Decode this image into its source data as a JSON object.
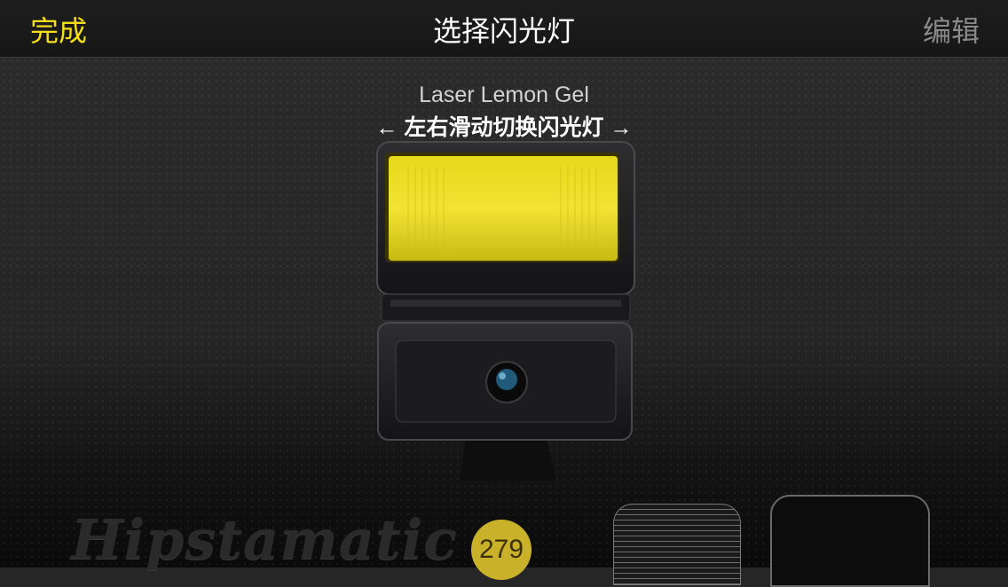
{
  "navbar": {
    "done_label": "完成",
    "title": "选择闪光灯",
    "edit_label": "编辑"
  },
  "flash": {
    "name": "Laser Lemon Gel",
    "swipe_hint": "← 左右滑动切换闪光灯 →",
    "gel_color": "#f0e020"
  },
  "bottom": {
    "logo_text": "Hipstamatic",
    "count_badge": "279"
  },
  "colors": {
    "accent": "#f5dd1a",
    "nav_disabled": "#8a8a8a",
    "badge": "#c9b12a"
  }
}
